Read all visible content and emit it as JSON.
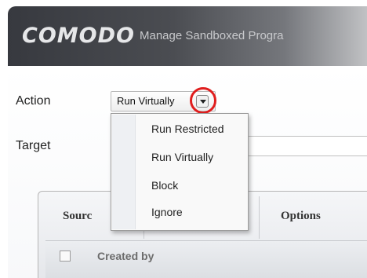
{
  "window": {
    "brand": "COMODO",
    "title": "Manage Sandboxed Progra"
  },
  "form": {
    "action_label": "Action",
    "action_value": "Run Virtually",
    "target_label": "Target",
    "target_value": ""
  },
  "dropdown": {
    "items": [
      "Run Restricted",
      "Run Virtually",
      "Block",
      "Ignore"
    ]
  },
  "tabs": {
    "source_label": "Sourc",
    "options_label": "Options"
  },
  "list": {
    "header_label": "Created by"
  },
  "colors": {
    "highlight_ring": "#e01e1e",
    "title_bar": "#3d3f44"
  },
  "icons": [
    "chevron-down-icon"
  ]
}
